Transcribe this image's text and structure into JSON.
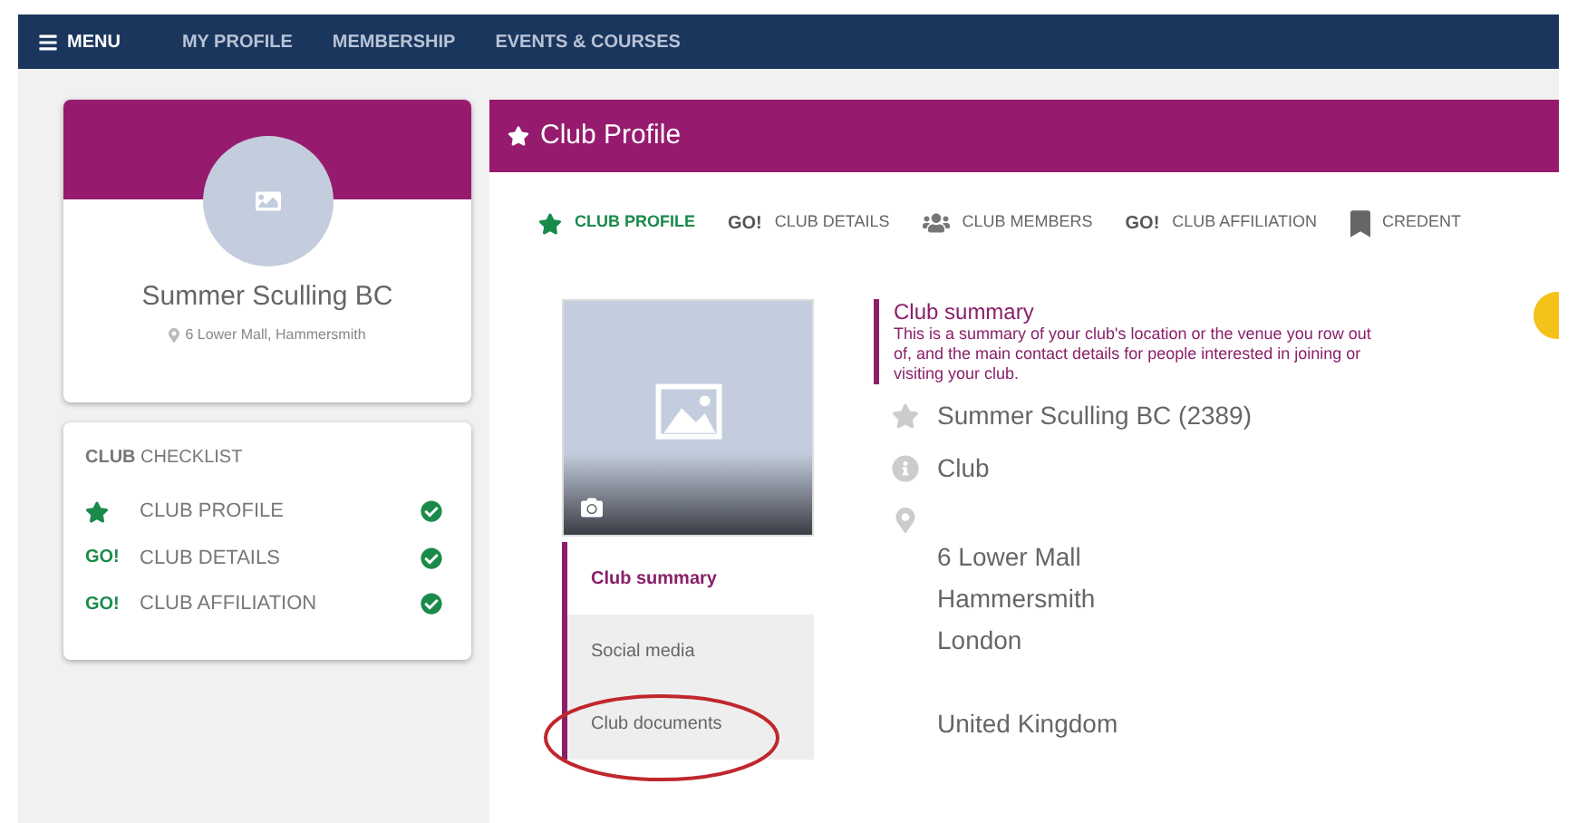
{
  "nav": {
    "menu": "MENU",
    "links": [
      "MY PROFILE",
      "MEMBERSHIP",
      "EVENTS & COURSES"
    ]
  },
  "profile_card": {
    "name": "Summer Sculling BC",
    "address": "6 Lower Mall, Hammersmith"
  },
  "checklist": {
    "title": "**CLUB** CHECKLIST",
    "items": [
      {
        "kind": "star",
        "label": "CLUB PROFILE",
        "done": true
      },
      {
        "kind": "go",
        "badge": "GO!",
        "label": "CLUB DETAILS",
        "done": true
      },
      {
        "kind": "go",
        "badge": "GO!",
        "label": "CLUB AFFILIATION",
        "done": true
      }
    ]
  },
  "panel": {
    "title": "Club Profile",
    "tabs": [
      {
        "kind": "star",
        "label": "CLUB PROFILE",
        "selected": true
      },
      {
        "kind": "go",
        "badge": "GO!",
        "label": "CLUB DETAILS",
        "selected": false
      },
      {
        "kind": "members",
        "label": "CLUB MEMBERS",
        "selected": false
      },
      {
        "kind": "go",
        "badge": "GO!",
        "label": "CLUB AFFILIATION",
        "selected": false
      },
      {
        "kind": "bookmark",
        "label": "CREDENT",
        "selected": false
      }
    ],
    "side_nav": [
      {
        "label": "Club summary",
        "selected": true
      },
      {
        "label": "Social media",
        "selected": false
      },
      {
        "label": "Club documents",
        "selected": false,
        "circled": true
      }
    ],
    "summary": {
      "title": "Club summary",
      "text": "This is a summary of your club's location or the venue you row out of, and the main contact details for people interested in joining or visiting your club."
    },
    "details": [
      {
        "kind": "star",
        "lines": [
          "Summer Sculling BC (2389)"
        ]
      },
      {
        "kind": "info",
        "lines": [
          "Club"
        ]
      },
      {
        "kind": "pin",
        "lines": [
          "6 Lower Mall",
          "Hammersmith",
          "London"
        ],
        "extra": [
          "United Kingdom"
        ]
      }
    ]
  }
}
